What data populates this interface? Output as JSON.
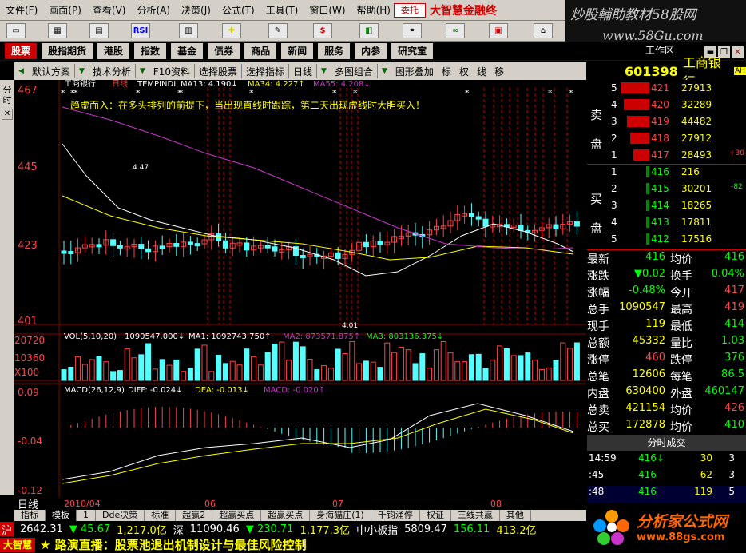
{
  "menu": {
    "items": [
      "文件(F)",
      "画面(P)",
      "查看(V)",
      "分析(A)",
      "决策(J)",
      "公式(T)",
      "工具(T)",
      "窗口(W)",
      "帮助(H)"
    ],
    "weituo": "委托",
    "brand": "大智慧金融终"
  },
  "watermark": {
    "line1": "炒股輔助教材58股网",
    "line2": "www.58Gu.com"
  },
  "toolbar": {
    "rsi": "RSI",
    "dollar": "$"
  },
  "nav": {
    "items": [
      "股票",
      "股指期货",
      "港股",
      "指数",
      "基金",
      "债券",
      "商品",
      "新闻",
      "服务",
      "内参",
      "研究室"
    ],
    "workarea": "工作区"
  },
  "controls": {
    "items": [
      "默认方案",
      "技术分析",
      "F10资料",
      "选择股票",
      "选择指标",
      "日线",
      "多图组合",
      "图形叠加",
      "标",
      "权",
      "线",
      "移"
    ]
  },
  "stock": {
    "code": "601398",
    "name": "工商银行",
    "badge": "AH"
  },
  "leftstrip": {
    "label": "分时"
  },
  "chart": {
    "title": "工商银行",
    "period": "日线",
    "formula": "TEMPINDI",
    "ma13": "MA13: 4.190↓",
    "ma34": "MA34: 4.227↑",
    "ma55": "MA55: 4.208↓",
    "note": "趋虚而入：在多头排列的前提下，当出现直线时跟踪，第二天出现虚线时大胆买入！",
    "high_label": "4.47",
    "low_label": "4.01",
    "price_ticks": [
      "467",
      "445",
      "423",
      "401"
    ],
    "vol_header": "VOL(5,10,20)",
    "vol_value": "1090547.000↓",
    "vol_ma1": "MA1: 1092743.750↑",
    "vol_ma2": "MA2: 873571.875↑",
    "vol_ma3": "MA3: 803136.375↓",
    "vol_ticks": [
      "20720",
      "10360",
      "X100"
    ],
    "macd_header": "MACD(26,12,9)",
    "diff": "DIFF: -0.024↓",
    "dea": "DEA: -0.013↓",
    "macd": "MACD: -0.020↑",
    "macd_ticks": [
      "0.09",
      "-0.04",
      "-0.12"
    ],
    "dates": [
      "2010/04",
      "06",
      "07",
      "08"
    ]
  },
  "quote": {
    "sell": [
      {
        "lv": "5",
        "p": "421",
        "v": "27913",
        "c": ""
      },
      {
        "lv": "4",
        "p": "420",
        "v": "32289",
        "c": ""
      },
      {
        "lv": "3",
        "p": "419",
        "v": "44482",
        "c": ""
      },
      {
        "lv": "2",
        "p": "418",
        "v": "27912",
        "c": ""
      },
      {
        "lv": "1",
        "p": "417",
        "v": "28493",
        "c": "+30"
      }
    ],
    "buy": [
      {
        "lv": "1",
        "p": "416",
        "v": "216",
        "c": ""
      },
      {
        "lv": "2",
        "p": "415",
        "v": "30201",
        "c": "-82"
      },
      {
        "lv": "3",
        "p": "414",
        "v": "18265",
        "c": ""
      },
      {
        "lv": "4",
        "p": "413",
        "v": "17811",
        "c": ""
      },
      {
        "lv": "5",
        "p": "412",
        "v": "17516",
        "c": ""
      }
    ],
    "sell_label": [
      "卖",
      "盘"
    ],
    "buy_label": [
      "买",
      "盘"
    ],
    "stats": [
      {
        "a": "最新",
        "av": "416",
        "b": "均价",
        "bv": "416"
      },
      {
        "a": "涨跌",
        "av": "▼0.02",
        "b": "换手",
        "bv": "0.04%"
      },
      {
        "a": "涨幅",
        "av": "-0.48%",
        "b": "今开",
        "bv": "417"
      },
      {
        "a": "总手",
        "av": "1090547",
        "b": "最高",
        "bv": "419"
      },
      {
        "a": "现手",
        "av": "119",
        "b": "最低",
        "bv": "414"
      },
      {
        "a": "总额",
        "av": "45332",
        "b": "量比",
        "bv": "1.03"
      },
      {
        "a": "涨停",
        "av": "460",
        "b": "跌停",
        "bv": "376"
      },
      {
        "a": "总笔",
        "av": "12606",
        "b": "每笔",
        "bv": "86.5"
      },
      {
        "a": "内盘",
        "av": "630400",
        "b": "外盘",
        "bv": "460147"
      },
      {
        "a": "总卖",
        "av": "421154",
        "b": "均价",
        "bv": "426"
      },
      {
        "a": "总买",
        "av": "172878",
        "b": "均价",
        "bv": "410"
      }
    ],
    "ticks_title": "分时成交",
    "ticks": [
      {
        "t": "14:59",
        "p": "416↓",
        "v": "30",
        "n": "3"
      },
      {
        "t": ":45",
        "p": "416",
        "v": "62",
        "n": "3"
      },
      {
        "t": ":48",
        "p": "416",
        "v": "119",
        "n": "5"
      }
    ]
  },
  "day_label": "日线",
  "tabs": [
    "指标",
    "模板",
    "1",
    "Dde决策",
    "标准",
    "超赢2",
    "超赢买点",
    "超赢买点",
    "身海猫庄(1)",
    "千钧涌停",
    "权证",
    "三线共赢",
    "其他"
  ],
  "market": {
    "sh": "沪",
    "sh_val": "2642.31",
    "sh_chg": "▼ 45.67",
    "sh_amt": "1,217.0亿",
    "sz": "深",
    "sz_val": "11090.46",
    "sz_chg": "▼ 230.71",
    "sz_amt": "1,177.3亿",
    "zx": "中小板指",
    "zx_val": "5809.47",
    "zx_chg": "156.11",
    "zx_amt": "413.2亿"
  },
  "ticker": {
    "logo": "大智慧",
    "text": "★ 路演直播：股票池退出机制设计与最佳风险控制"
  },
  "site": {
    "name": "分析家公式网",
    "url": "www.88gs.com"
  }
}
